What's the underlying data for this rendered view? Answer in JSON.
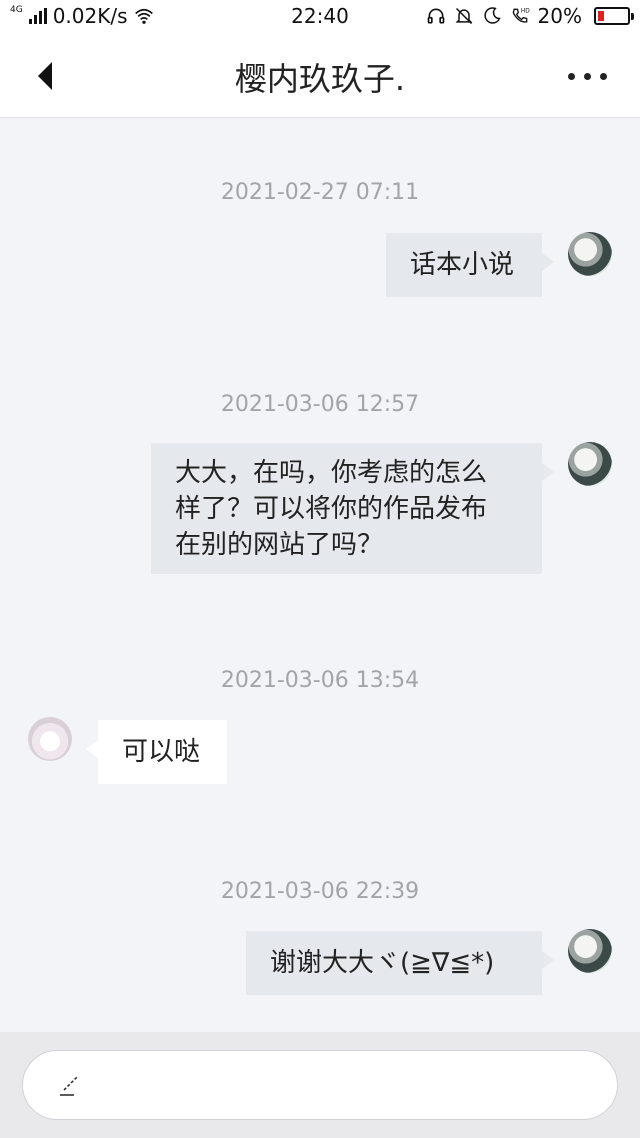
{
  "status_bar": {
    "network_type": "4G",
    "net_speed": "0.02K/s",
    "time": "22:40",
    "battery_percent": "20%",
    "battery_level": 0.2,
    "battery_color": "#e02020",
    "icons": [
      "signal-icon",
      "wifi-icon",
      "headset-icon",
      "mute-icon",
      "moon-icon",
      "hd-call-icon",
      "battery-icon"
    ]
  },
  "header": {
    "title": "樱内玖玖子.",
    "back_icon": "back-arrow-icon",
    "more_icon": "more-dots-icon"
  },
  "messages": [
    {
      "timestamp": "2021-02-27 07:11",
      "direction": "outgoing",
      "lines": [
        "话本小说"
      ]
    },
    {
      "timestamp": "2021-03-06 12:57",
      "direction": "outgoing",
      "lines": [
        "大大，在吗，你考虑的怎么",
        "样了？可以将你的作品发布",
        "在别的网站了吗？"
      ]
    },
    {
      "timestamp": "2021-03-06 13:54",
      "direction": "incoming",
      "lines": [
        "可以哒"
      ]
    },
    {
      "timestamp": "2021-03-06 22:39",
      "direction": "outgoing",
      "lines": [
        "谢谢大大ヾ(≧∇≦*)"
      ]
    }
  ],
  "input": {
    "value": "",
    "placeholder": "",
    "icon": "pen-icon"
  },
  "colors": {
    "background": "#f3f4f8",
    "outgoing_bubble": "#e5e9ee",
    "incoming_bubble": "#ffffff",
    "timestamp_text": "#a2a4aa"
  }
}
